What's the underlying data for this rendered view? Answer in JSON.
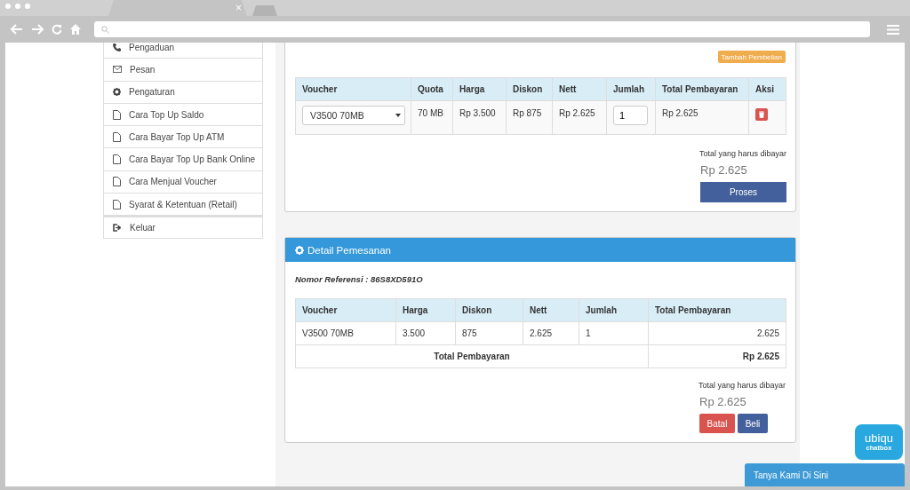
{
  "browser": {
    "tab_close": "×"
  },
  "sidebar": {
    "items": [
      {
        "label": "Pengaduan",
        "kind": "complaint"
      },
      {
        "label": "Pesan",
        "kind": "message"
      },
      {
        "label": "Pengaturan",
        "kind": "settings"
      },
      {
        "label": "Cara Top Up Saldo",
        "kind": "page"
      },
      {
        "label": "Cara Bayar Top Up ATM",
        "kind": "page"
      },
      {
        "label": "Cara Bayar Top Up Bank Online",
        "kind": "page"
      },
      {
        "label": "Cara Menjual Voucher",
        "kind": "page"
      },
      {
        "label": "Syarat & Ketentuan (Retail)",
        "kind": "page"
      },
      {
        "label": "Keluar",
        "kind": "exit"
      }
    ]
  },
  "purchase": {
    "add_button": "Tambah Pembelian",
    "columns": [
      "Voucher",
      "Quota",
      "Harga",
      "Diskon",
      "Nett",
      "Jumlah",
      "Total Pembayaran",
      "Aksi"
    ],
    "rows": [
      {
        "voucher": "V3500 70MB",
        "quota": "70 MB",
        "harga": "Rp 3.500",
        "diskon": "Rp 875",
        "nett": "Rp 2.625",
        "jumlah": "1",
        "total": "Rp 2.625"
      }
    ],
    "total_label": "Total yang harus dibayar",
    "total_amount": "Rp 2.625",
    "process_button": "Proses"
  },
  "detail": {
    "title": "Detail Pemesanan",
    "reference": "Nomor Referensi : 86S8XD591O",
    "columns": [
      "Voucher",
      "Harga",
      "Diskon",
      "Nett",
      "Jumlah",
      "Total Pembayaran"
    ],
    "rows": [
      [
        "V3500 70MB",
        "3.500",
        "875",
        "2.625",
        "1",
        "2.625"
      ]
    ],
    "footer_label": "Total Pembayaran",
    "footer_value": "Rp 2.625",
    "total_label": "Total yang harus dibayar",
    "total_amount": "Rp 2.625",
    "buttons": [
      {
        "label": "Batal",
        "kind": "danger"
      },
      {
        "label": "Beli",
        "kind": "primary"
      }
    ]
  },
  "chat": {
    "logo_top": "ubiqu",
    "logo_bottom": "chatbox",
    "bar": "Tanya Kami Di Sini"
  }
}
